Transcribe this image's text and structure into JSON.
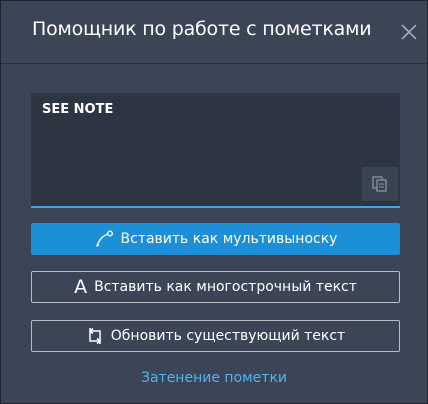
{
  "dialog": {
    "title": "Помощник по работе с пометками",
    "close_icon": "close-icon"
  },
  "editor": {
    "value": "SEE NOTE",
    "copy_icon": "copy-icon"
  },
  "actions": {
    "insert_multileader": {
      "label": "Вставить как мультивыноску",
      "icon": "multileader-icon"
    },
    "insert_mtext": {
      "label": "Вставить как многострочный текст",
      "icon_glyph": "A",
      "icon": "mtext-icon"
    },
    "update_text": {
      "label": "Обновить существующий текст",
      "icon": "refresh-icon"
    }
  },
  "markup_shading_link": "Затенение пометки",
  "colors": {
    "panel_bg": "#3c4556",
    "primary": "#1c8fd6",
    "accent_line": "#3ea6e6",
    "link": "#53b2ef"
  }
}
